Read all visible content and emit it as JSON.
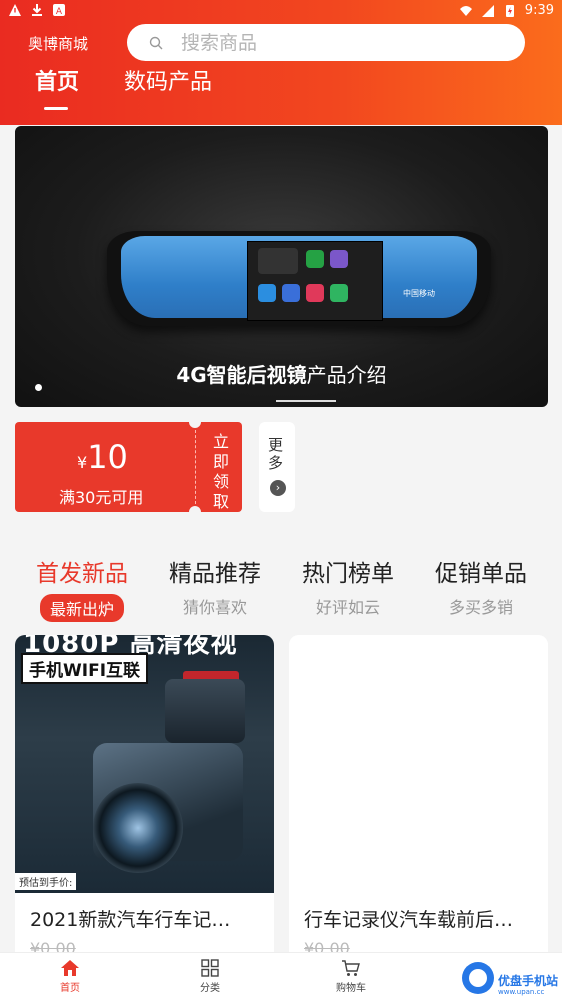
{
  "status_bar": {
    "time": "9:39"
  },
  "header": {
    "store_name": "奥博商城",
    "search_placeholder": "搜索商品"
  },
  "tabs": [
    {
      "label": "首页",
      "active": true
    },
    {
      "label": "数码产品",
      "active": false
    }
  ],
  "banner": {
    "caption_bold": "4G智能后视镜",
    "caption_rest": "产品介绍",
    "logo_text": "中国移动"
  },
  "coupon": {
    "currency": "¥",
    "amount": "10",
    "condition": "满30元可用",
    "claim": "立即领取"
  },
  "more": {
    "label": "更多"
  },
  "categories": [
    {
      "title": "首发新品",
      "subtitle": "最新出炉",
      "active": true
    },
    {
      "title": "精品推荐",
      "subtitle": "猜你喜欢",
      "active": false
    },
    {
      "title": "热门榜单",
      "subtitle": "好评如云",
      "active": false
    },
    {
      "title": "促销单品",
      "subtitle": "多买多销",
      "active": false
    }
  ],
  "products": [
    {
      "title": "2021新款汽车行车记…",
      "price": "¥0.00",
      "image_text_top": "1080P 高清夜视",
      "image_tag": "手机WIFI互联",
      "image_badge": "预估到手价:"
    },
    {
      "title": "行车记录仪汽车载前后…",
      "price": "¥0.00"
    }
  ],
  "bottom_nav": [
    {
      "label": "首页",
      "icon": "home-icon",
      "active": true
    },
    {
      "label": "分类",
      "icon": "grid-icon",
      "active": false
    },
    {
      "label": "购物车",
      "icon": "cart-icon",
      "active": false
    }
  ],
  "watermark": {
    "text": "优盘手机站",
    "sub": "www.upan.cc"
  },
  "colors": {
    "accent": "#e8392b",
    "header_start": "#ea2b21",
    "header_end": "#fb6c1c"
  }
}
